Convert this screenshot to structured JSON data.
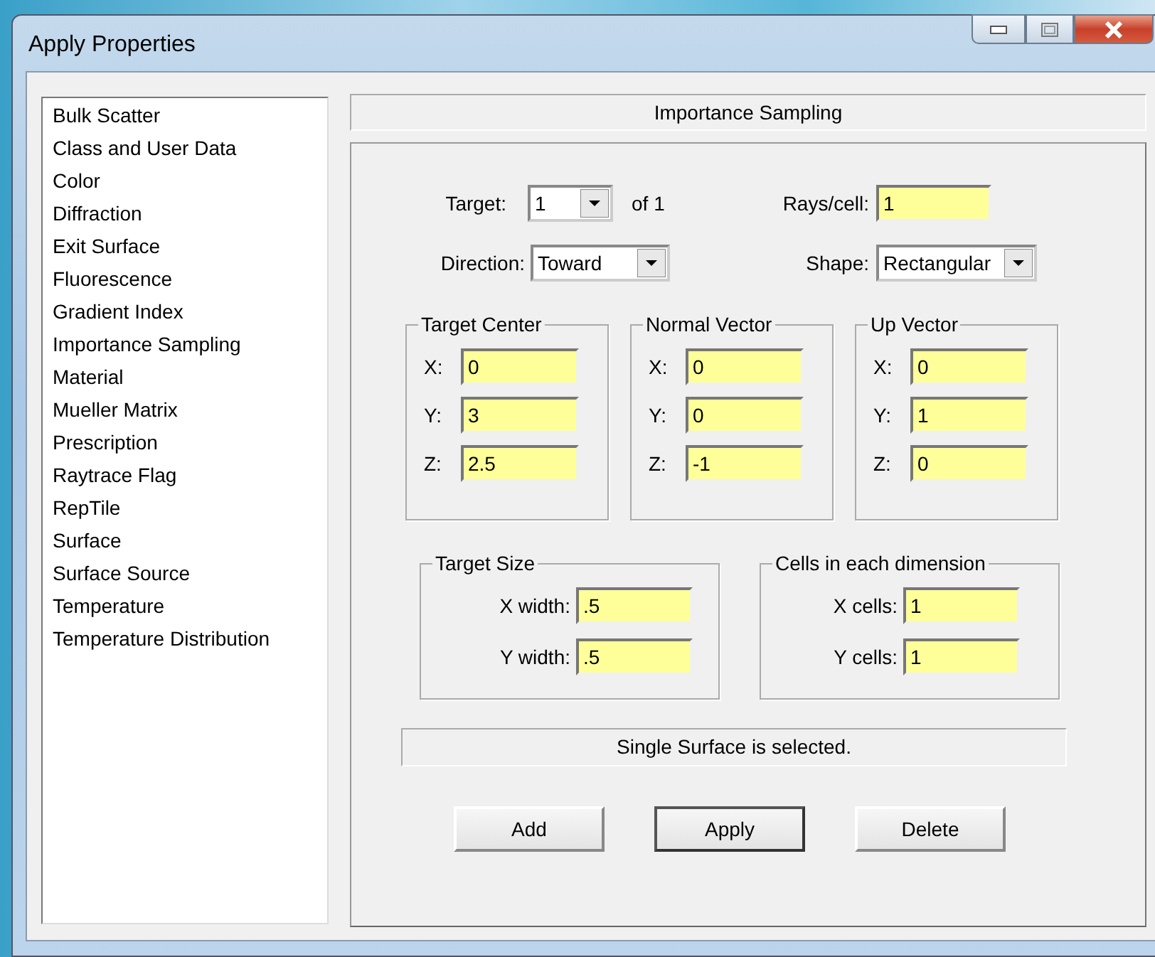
{
  "window": {
    "title": "Apply Properties"
  },
  "sidebar": {
    "items": [
      "Bulk Scatter",
      "Class and User Data",
      "Color",
      "Diffraction",
      "Exit Surface",
      "Fluorescence",
      "Gradient Index",
      "Importance Sampling",
      "Material",
      "Mueller Matrix",
      "Prescription",
      "Raytrace Flag",
      "RepTile",
      "Surface",
      "Surface Source",
      "Temperature",
      "Temperature Distribution"
    ]
  },
  "panel": {
    "title": "Importance Sampling",
    "target": {
      "label": "Target:",
      "value": "1",
      "suffix": "of 1"
    },
    "rays_per_cell": {
      "label": "Rays/cell:",
      "value": "1"
    },
    "direction": {
      "label": "Direction:",
      "value": "Toward"
    },
    "shape": {
      "label": "Shape:",
      "value": "Rectangular"
    },
    "vector_groups": [
      {
        "title": "Target Center",
        "fields": [
          {
            "label": "X:",
            "value": "0"
          },
          {
            "label": "Y:",
            "value": "3"
          },
          {
            "label": "Z:",
            "value": "2.5"
          }
        ]
      },
      {
        "title": "Normal Vector",
        "fields": [
          {
            "label": "X:",
            "value": "0"
          },
          {
            "label": "Y:",
            "value": "0"
          },
          {
            "label": "Z:",
            "value": "-1"
          }
        ]
      },
      {
        "title": "Up Vector",
        "fields": [
          {
            "label": "X:",
            "value": "0"
          },
          {
            "label": "Y:",
            "value": "1"
          },
          {
            "label": "Z:",
            "value": "0"
          }
        ]
      }
    ],
    "size_groups": [
      {
        "title": "Target Size",
        "fields": [
          {
            "label": "X width:",
            "value": ".5"
          },
          {
            "label": "Y width:",
            "value": ".5"
          }
        ]
      },
      {
        "title": "Cells in each dimension",
        "fields": [
          {
            "label": "X cells:",
            "value": "1"
          },
          {
            "label": "Y cells:",
            "value": "1"
          }
        ]
      }
    ],
    "status": "Single Surface is selected.",
    "buttons": [
      {
        "label": "Add",
        "default": false
      },
      {
        "label": "Apply",
        "default": true
      },
      {
        "label": "Delete",
        "default": false
      }
    ]
  }
}
